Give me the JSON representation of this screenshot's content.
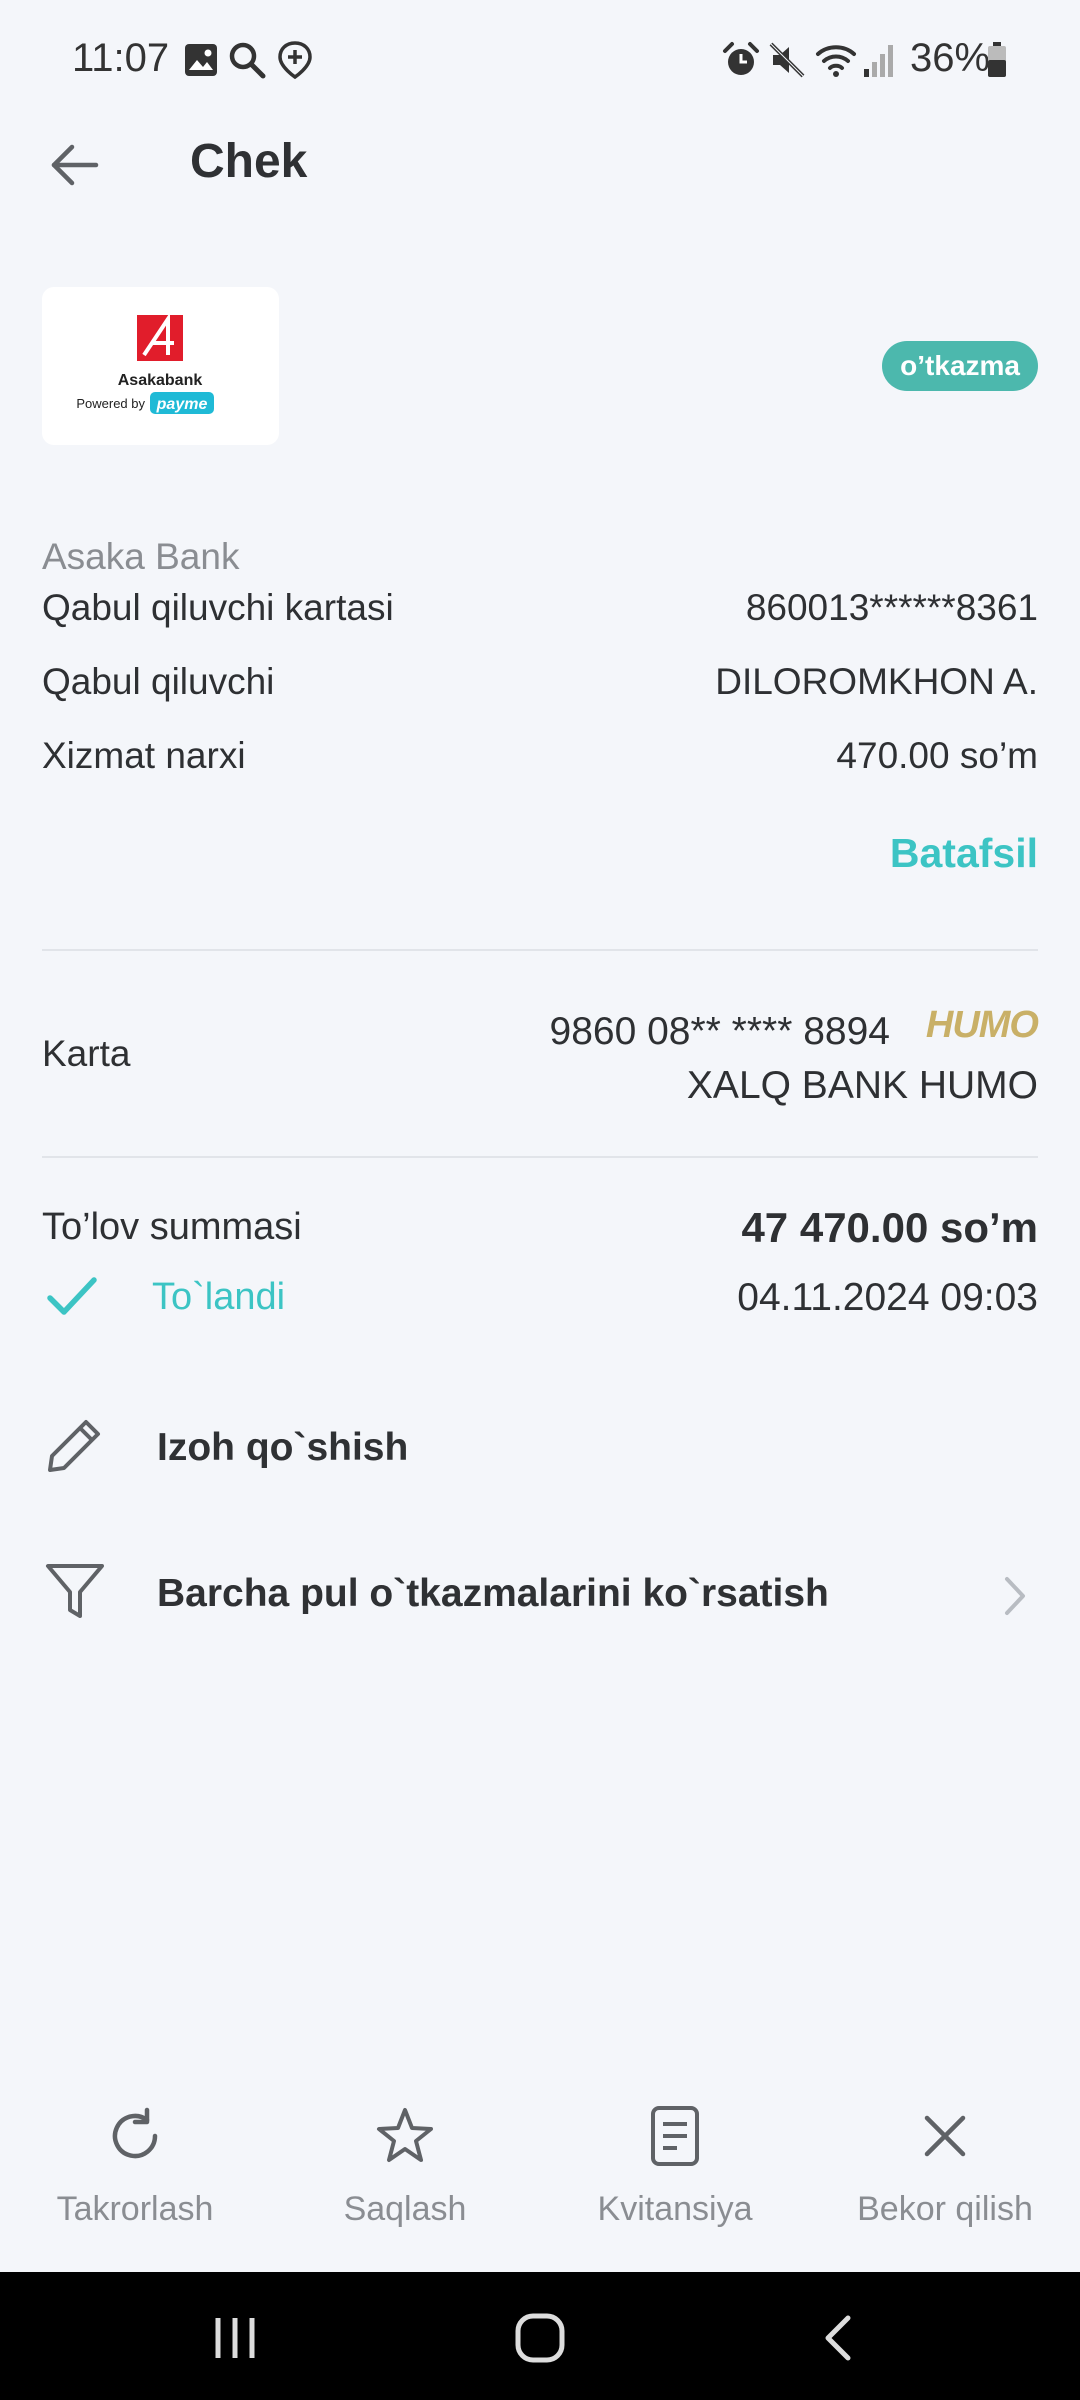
{
  "status_bar": {
    "time": "11:07",
    "battery": "36%"
  },
  "header": {
    "title": "Chek"
  },
  "merchant": {
    "logo_name": "Asakabank",
    "logo_powered": "Powered by",
    "logo_brand": "payme",
    "badge": "o’tkazma"
  },
  "details": {
    "bank_name": "Asaka Bank",
    "rows": [
      {
        "label": "Qabul qiluvchi kartasi",
        "value": "860013******8361"
      },
      {
        "label": "Qabul qiluvchi",
        "value": "DILOROMKHON A."
      },
      {
        "label": "Xizmat narxi",
        "value": "470.00 so’m"
      }
    ],
    "more_link": "Batafsil"
  },
  "card": {
    "label": "Karta",
    "number": "9860 08** **** 8894",
    "brand": "HUMO",
    "bank": "XALQ BANK HUMO"
  },
  "payment": {
    "label": "To’lov summasi",
    "amount": "47 470.00 so’m",
    "status": "To`landi",
    "date": "04.11.2024 09:03"
  },
  "actions": {
    "comment": "Izoh qo`shish",
    "all_transfers": "Barcha pul o`tkazmalarini ko`rsatish"
  },
  "bottom": {
    "repeat": "Takrorlash",
    "save": "Saqlash",
    "receipt": "Kvitansiya",
    "cancel": "Bekor qilish"
  },
  "colors": {
    "accent": "#3cc4c4",
    "badge": "#4cb8ad",
    "humo": "#c9b067",
    "background": "#f4f6fa"
  }
}
